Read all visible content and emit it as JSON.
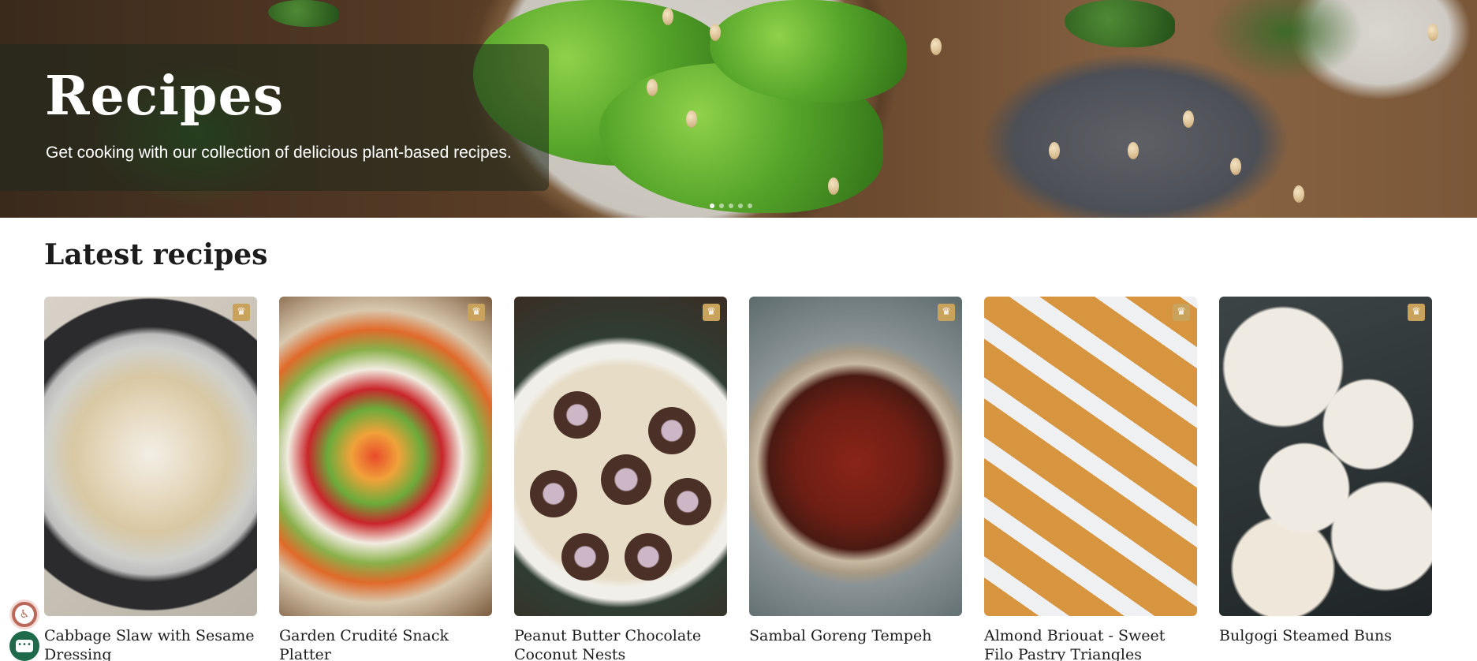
{
  "hero": {
    "title": "Recipes",
    "subtitle": "Get cooking with our collection of delicious plant-based recipes.",
    "slides_total": 5,
    "active_slide": 1
  },
  "latest": {
    "heading": "Latest recipes",
    "cards": [
      {
        "title": "Cabbage Slaw with Sesame Dressing",
        "premium": true,
        "badge_icon": "crown-icon"
      },
      {
        "title": "Garden Crudité Snack Platter",
        "premium": true,
        "badge_icon": "crown-icon"
      },
      {
        "title": "Peanut Butter Chocolate Coconut Nests",
        "premium": true,
        "badge_icon": "crown-icon"
      },
      {
        "title": "Sambal Goreng Tempeh",
        "premium": true,
        "badge_icon": "crown-icon"
      },
      {
        "title": "Almond Briouat - Sweet Filo Pastry Triangles",
        "premium": true,
        "badge_icon": "crown-icon"
      },
      {
        "title": "Bulgogi Steamed Buns",
        "premium": true,
        "badge_icon": "crown-icon"
      }
    ]
  },
  "widgets": {
    "accessibility_icon": "accessibility-icon",
    "chat_icon": "chat-icon"
  },
  "colors": {
    "badge": "#c9a25b",
    "accessibility_button": "#b9685a",
    "chat_button": "#1f6a4a"
  }
}
